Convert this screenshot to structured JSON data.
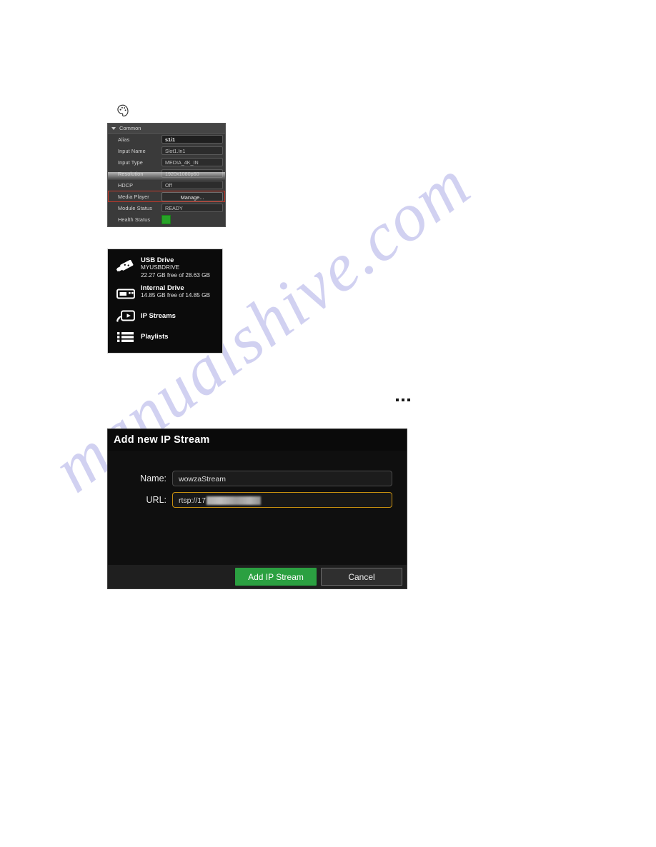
{
  "watermark": {
    "text": "manualshive.com"
  },
  "toolbar": {
    "palette_icon": "palette-icon"
  },
  "properties_panel": {
    "section_title": "Common",
    "rows": [
      {
        "label": "Alias",
        "value": "s1i1",
        "kind": "alias"
      },
      {
        "label": "Input Name",
        "value": "Slot1.In1",
        "kind": "text"
      },
      {
        "label": "Input Type",
        "value": "MEDIA_4K_IN",
        "kind": "text"
      },
      {
        "label": "Resolution",
        "value": "1920x1080p60",
        "kind": "text"
      },
      {
        "label": "HDCP",
        "value": "Off",
        "kind": "text"
      },
      {
        "label": "Media Player",
        "value": "Manage...",
        "kind": "button"
      },
      {
        "label": "Module Status",
        "value": "READY",
        "kind": "text"
      },
      {
        "label": "Health Status",
        "value": "",
        "kind": "swatch"
      }
    ],
    "health_color": "#27a327",
    "highlight_color": "#c0392b"
  },
  "media_sources": {
    "items": [
      {
        "icon": "usb-drive-icon",
        "title": "USB Drive",
        "sub1": "MYUSBDRIVE",
        "sub2": "22.27 GB free of 28.63 GB"
      },
      {
        "icon": "internal-drive-icon",
        "title": "Internal Drive",
        "sub1": "14.85 GB free of 14.85 GB",
        "sub2": ""
      },
      {
        "icon": "ip-streams-icon",
        "title": "IP Streams",
        "sub1": "",
        "sub2": ""
      },
      {
        "icon": "playlists-icon",
        "title": "Playlists",
        "sub1": "",
        "sub2": ""
      }
    ]
  },
  "overflow": {
    "icon": "ellipsis-icon"
  },
  "dialog": {
    "title": "Add new IP Stream",
    "fields": [
      {
        "label": "Name:",
        "value": "wowzaStream",
        "focused": false
      },
      {
        "label": "URL:",
        "value": "rtsp://17",
        "focused": true,
        "redacted": true
      }
    ],
    "buttons": {
      "primary": "Add IP Stream",
      "secondary": "Cancel"
    },
    "accent_color": "#2ba041",
    "focus_border_color": "#c8900f"
  }
}
